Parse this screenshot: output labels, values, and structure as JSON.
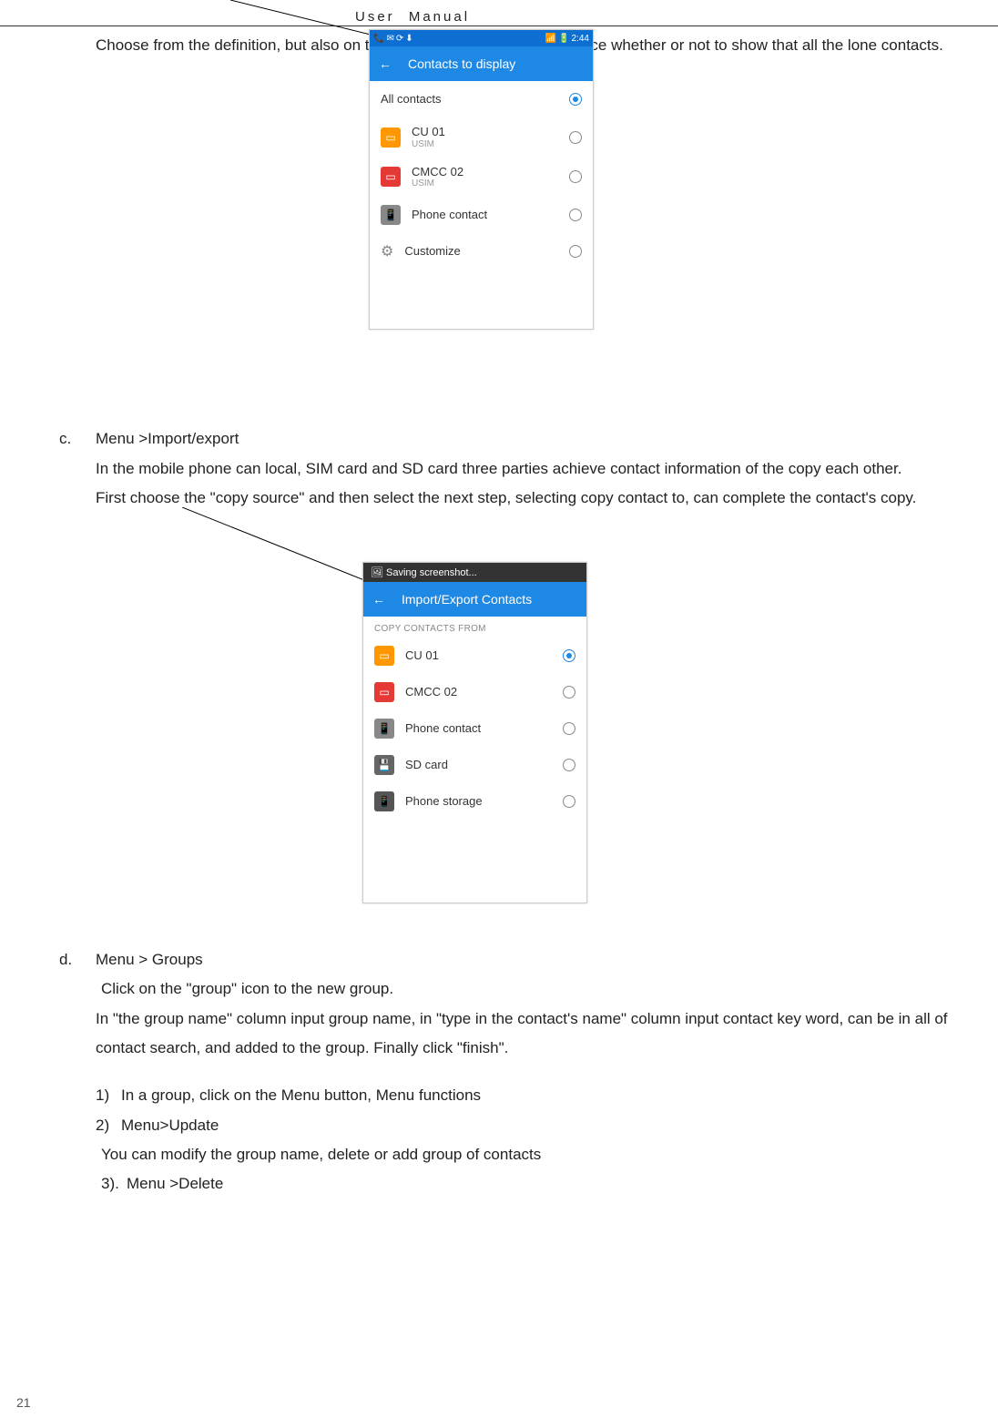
{
  "header": {
    "title": "User  Manual"
  },
  "intro_para": "Choose from the definition, but also on the SIM card and cell phone choice whether or not to show that all the lone contacts.",
  "items": {
    "c": {
      "label": "c.",
      "title": "Menu >Import/export",
      "para1": "In the mobile phone can local, SIM card and SD card three parties achieve contact information of the copy each other.",
      "para2": "First choose the \"copy source\" and then select the next step, selecting copy contact to, can complete the contact's copy."
    },
    "d": {
      "label": "d.",
      "title_prefix": "Menu > ",
      "title_suffix": "Groups",
      "line1": "Click on the \"group\" icon to the new group.",
      "para1": "In \"the group name\" column input group name, in \"type in the contact's name\" column input contact key word, can be in all of contact search, and added to the group.  Finally click \"finish\".",
      "sub1": {
        "num": "1)",
        "text": "In a group, click on the Menu button,   Menu functions"
      },
      "sub2": {
        "num": "2)",
        "text": "Menu>Update"
      },
      "sub2_desc": "You can modify the group name, delete or add group of contacts",
      "sub3": {
        "num": "3).",
        "text": "Menu >Delete"
      }
    }
  },
  "phone1": {
    "status_time": "2:44",
    "appbar": "Contacts to display",
    "rows": [
      {
        "label": "All contacts",
        "sub": "",
        "icon": "",
        "selected": true
      },
      {
        "label": "CU 01",
        "sub": "USIM",
        "icon": "sim-orange",
        "selected": false
      },
      {
        "label": "CMCC 02",
        "sub": "USIM",
        "icon": "sim-red",
        "selected": false
      },
      {
        "label": "Phone contact",
        "sub": "",
        "icon": "phone-grey",
        "selected": false
      },
      {
        "label": "Customize",
        "sub": "",
        "icon": "gear",
        "selected": false
      }
    ]
  },
  "phone2": {
    "saving": "Saving screenshot...",
    "appbar": "Import/Export Contacts",
    "section": "COPY CONTACTS FROM",
    "rows": [
      {
        "label": "CU 01",
        "icon": "sim-orange",
        "selected": true
      },
      {
        "label": "CMCC 02",
        "icon": "sim-red",
        "selected": false
      },
      {
        "label": "Phone contact",
        "icon": "phone-grey",
        "selected": false
      },
      {
        "label": "SD card",
        "icon": "sd-grey",
        "selected": false
      },
      {
        "label": "Phone storage",
        "icon": "storage-grey",
        "selected": false
      }
    ]
  },
  "page_num": "21"
}
